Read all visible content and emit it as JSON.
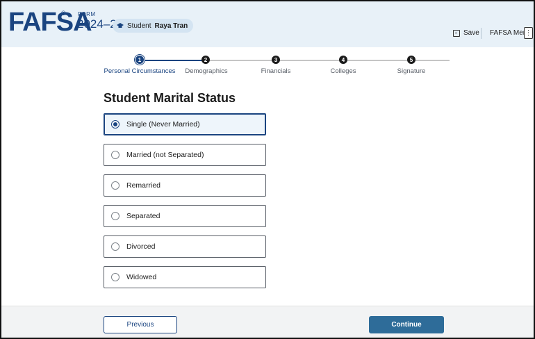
{
  "header": {
    "logo": "FAFSA",
    "registered": "®",
    "form_label": "FORM",
    "form_year": "2024–25",
    "student_prefix": "Student",
    "student_name": "Raya Tran",
    "save_label": "Save",
    "menu_label": "FAFSA Menu",
    "menu_button": "⋮"
  },
  "stepper": {
    "steps": [
      {
        "number": "1",
        "label": "Personal Circumstances",
        "active": true
      },
      {
        "number": "2",
        "label": "Demographics",
        "active": false
      },
      {
        "number": "3",
        "label": "Financials",
        "active": false
      },
      {
        "number": "4",
        "label": "Colleges",
        "active": false
      },
      {
        "number": "5",
        "label": "Signature",
        "active": false
      }
    ]
  },
  "page": {
    "title": "Student Marital Status"
  },
  "options": [
    {
      "label": "Single (Never Married)",
      "selected": true
    },
    {
      "label": "Married (not Separated)",
      "selected": false
    },
    {
      "label": "Remarried",
      "selected": false
    },
    {
      "label": "Separated",
      "selected": false
    },
    {
      "label": "Divorced",
      "selected": false
    },
    {
      "label": "Widowed",
      "selected": false
    }
  ],
  "footer": {
    "previous_label": "Previous",
    "continue_label": "Continue"
  },
  "colors": {
    "brand": "#1a4480",
    "header_bg": "#e8f1f8",
    "continue_bg": "#2e6c99"
  }
}
